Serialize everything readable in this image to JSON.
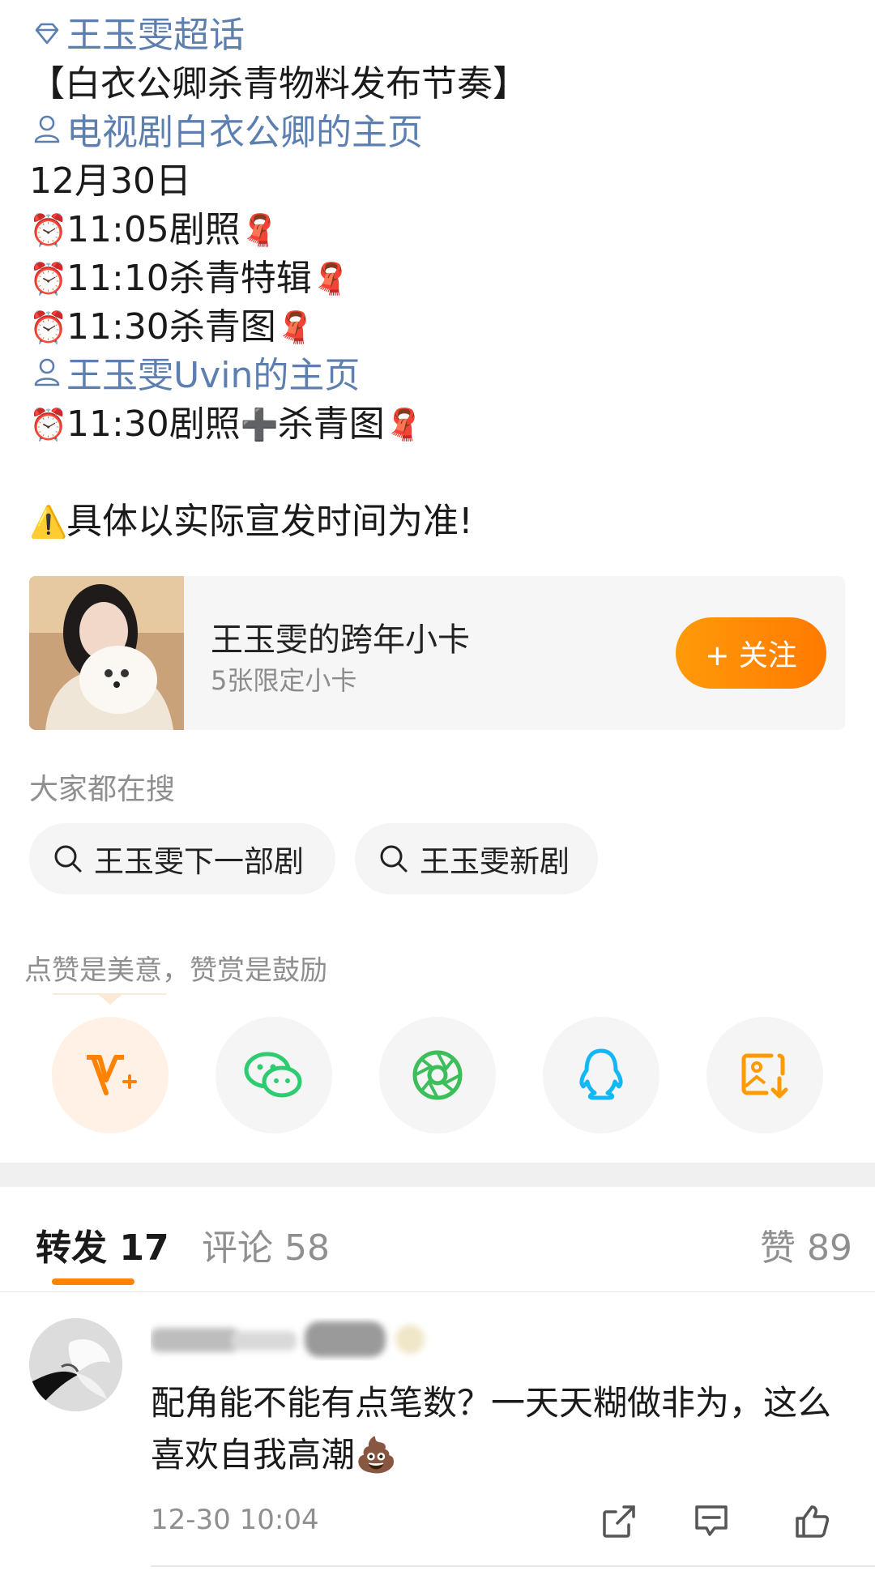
{
  "post": {
    "topic": "王玉雯超话",
    "heading": "【白衣公卿杀青物料发布节奏】",
    "account1": "电视剧白衣公卿的主页",
    "date": "12月30日",
    "schedule1": [
      {
        "time": "11:05",
        "item": "剧照"
      },
      {
        "time": "11:10",
        "item": "杀青特辑"
      },
      {
        "time": "11:30",
        "item": "杀青图"
      }
    ],
    "account2": "王玉雯Uvin的主页",
    "schedule2": {
      "time": "11:30",
      "item1": "剧照",
      "item2": "杀青图"
    },
    "notice": "具体以实际宣发时间为准!"
  },
  "card": {
    "title": "王玉雯的跨年小卡",
    "subtitle": "5张限定小卡",
    "follow_label": "+ 关注"
  },
  "search": {
    "title": "大家都在搜",
    "chips": [
      "王玉雯下一部剧",
      "王玉雯新剧"
    ]
  },
  "share": {
    "hint": "点赞是美意，赞赏是鼓励",
    "icons": [
      "reward-v-icon",
      "wechat-icon",
      "moments-icon",
      "qq-icon",
      "save-image-icon"
    ]
  },
  "tabs": {
    "repost_label": "转发",
    "repost_count": "17",
    "comment_label": "评论",
    "comment_count": "58",
    "like_label": "赞",
    "like_count": "89"
  },
  "comment": {
    "text": "配角能不能有点笔数？一天天糊做非为，这么喜欢自我高潮💩",
    "time": "12-30 10:04"
  },
  "colors": {
    "link": "#5d7fb0",
    "accent": "#ff8200",
    "wechat": "#2ecc71",
    "qq": "#12b7f5"
  }
}
